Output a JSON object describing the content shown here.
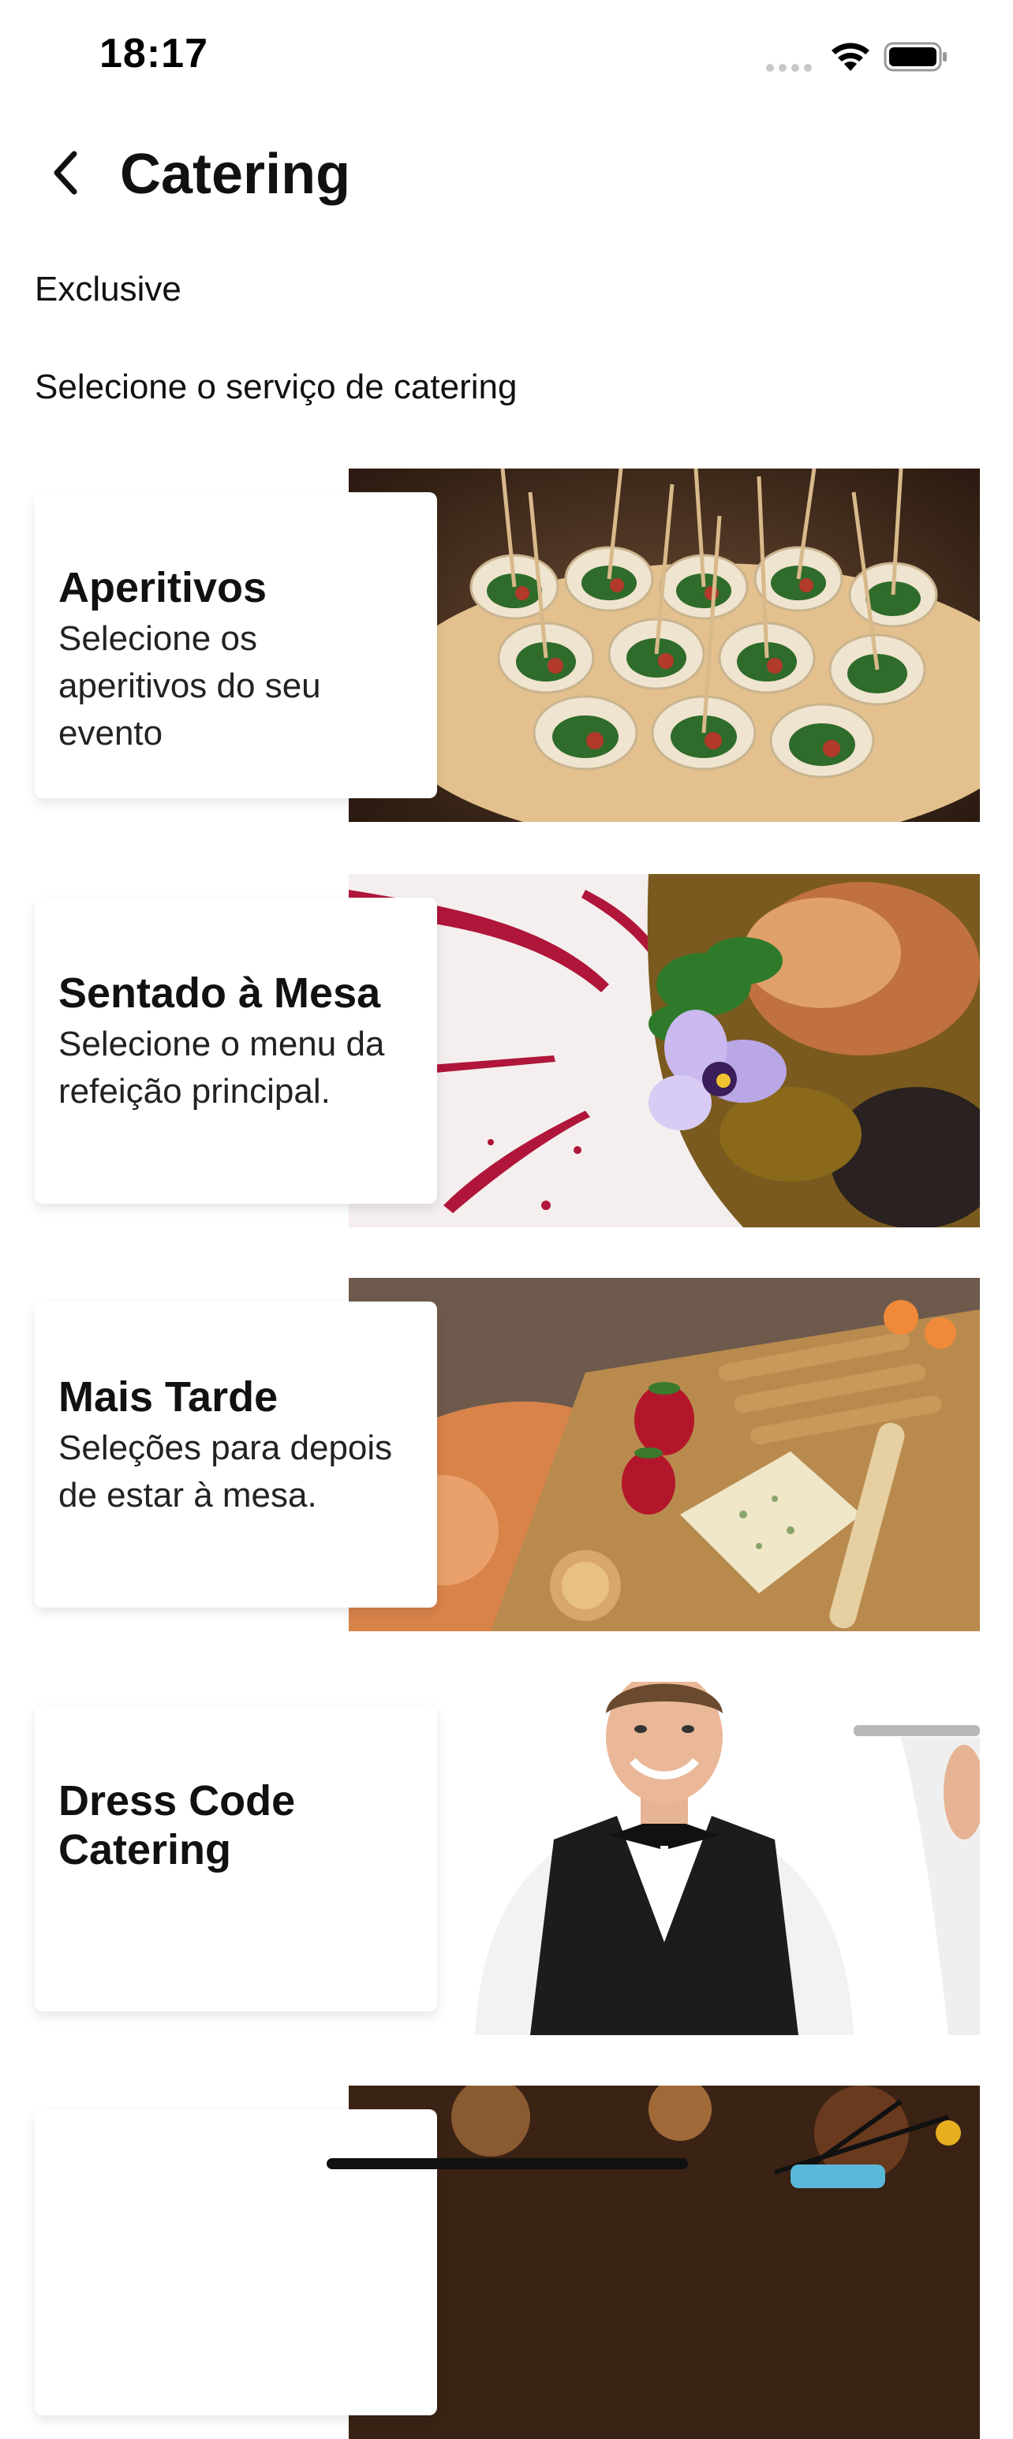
{
  "status_bar": {
    "time": "18:17"
  },
  "header": {
    "title": "Catering",
    "back_icon": "chevron-left-icon"
  },
  "venue": "Exclusive",
  "instructions": "Selecione o serviço de catering",
  "services": [
    {
      "title": "Aperitivos",
      "description": "Selecione os aperitivos do seu evento",
      "image": "wraps-skewers-photo"
    },
    {
      "title": "Sentado à Mesa",
      "description": "Selecione o menu da refeição principal.",
      "image": "plated-dish-flower-photo"
    },
    {
      "title": "Mais Tarde",
      "description": "Seleções para depois de estar à mesa.",
      "image": "cheese-platter-photo"
    },
    {
      "title": "Dress Code Catering",
      "description": "",
      "image": "waiter-photo"
    },
    {
      "title": "",
      "description": "",
      "image": "drinks-photo"
    }
  ],
  "colors": {
    "background": "#ffffff",
    "text": "#111111"
  }
}
